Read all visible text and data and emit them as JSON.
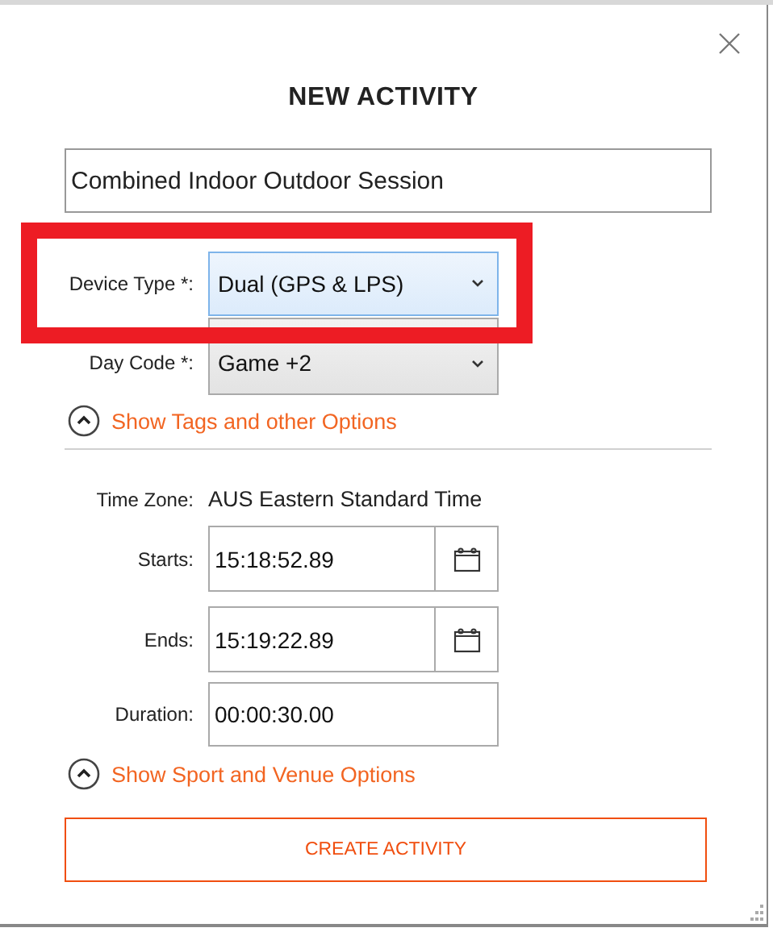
{
  "dialog": {
    "title": "NEW ACTIVITY",
    "name_field": {
      "value": "Combined Indoor Outdoor Session"
    },
    "select_fields": [
      {
        "label": "Device Type *:",
        "value": "Dual (GPS & LPS)",
        "highlighted": true,
        "focused": true
      },
      {
        "label": "Day Code *:",
        "value": "Game +2",
        "highlighted": false,
        "focused": false
      }
    ],
    "tags_toggle": {
      "label": "Show Tags and other Options"
    },
    "time_fields": [
      {
        "kind": "static",
        "label": "Time Zone:",
        "value": "AUS Eastern Standard Time"
      },
      {
        "kind": "datetime",
        "label": "Starts:",
        "value": "15:18:52.89"
      },
      {
        "kind": "datetime",
        "label": "Ends:",
        "value": "15:19:22.89"
      },
      {
        "kind": "input",
        "label": "Duration:",
        "value": "00:00:30.00"
      }
    ],
    "venue_toggle": {
      "label": "Show Sport and Venue Options"
    },
    "create_button": {
      "label": "CREATE ACTIVITY"
    }
  }
}
